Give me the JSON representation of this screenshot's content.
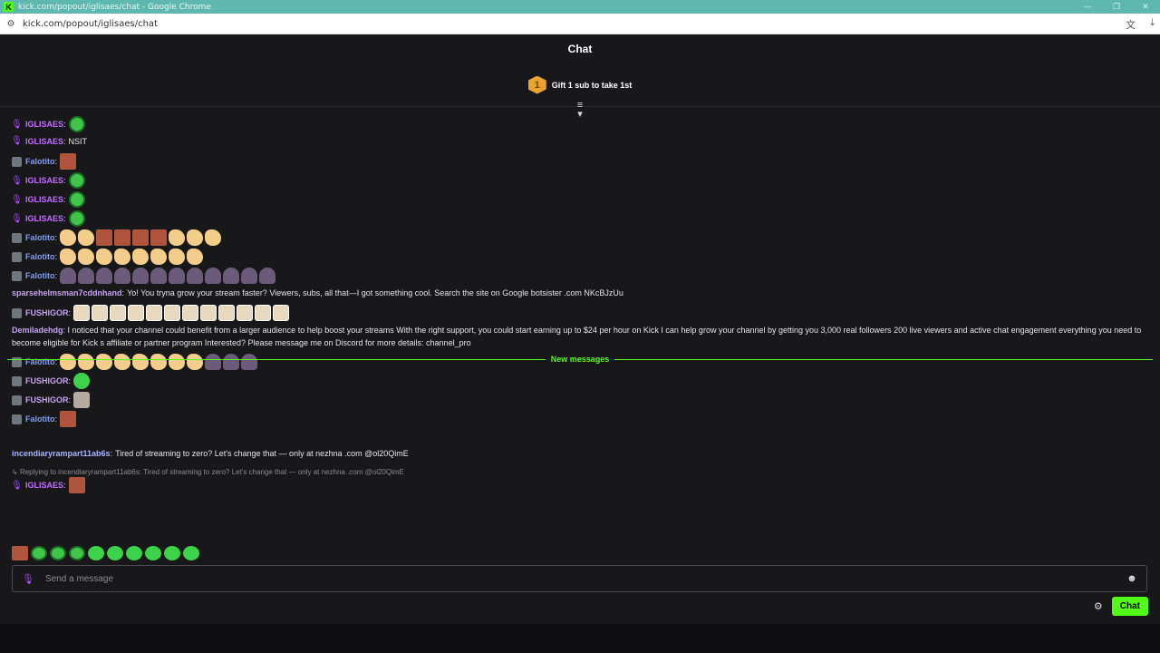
{
  "browser": {
    "window_title": "kick.com/popout/iglisaes/chat - Google Chrome",
    "url": "kick.com/popout/iglisaes/chat"
  },
  "chat": {
    "header": "Chat",
    "pinned_text": "Gift 1 sub to take 1st",
    "pinned_badge": "1",
    "new_messages_label": "New messages",
    "input_placeholder": "Send a message",
    "send_label": "Chat",
    "colors": {
      "accent": "#53fc18",
      "background": "#18181b",
      "mic": "#b04dff"
    }
  },
  "messages": [
    {
      "user": "IGLISAES",
      "badge": "mic",
      "text": ""
    },
    {
      "user": "IGLISAES",
      "badge": "mic",
      "text": "NSIT"
    },
    {
      "user": "Falotito",
      "badge": "sub",
      "text": ""
    },
    {
      "user": "IGLISAES",
      "badge": "mic",
      "text": ""
    },
    {
      "user": "IGLISAES",
      "badge": "mic",
      "text": ""
    },
    {
      "user": "IGLISAES",
      "badge": "mic",
      "text": ""
    },
    {
      "user": "Falotito",
      "badge": "sub",
      "text": ""
    },
    {
      "user": "Falotito",
      "badge": "sub",
      "text": ""
    },
    {
      "user": "Falotito",
      "badge": "sub",
      "text": ""
    },
    {
      "user": "sparsehelmsman7cddnhand",
      "badge": "",
      "text": "Yo! You tryna grow your stream faster? Viewers, subs, all that—I got something cool. Search the site on Google botsister .com NKcBJzUu"
    },
    {
      "user": "FUSHIGOR",
      "badge": "sub",
      "text": ""
    },
    {
      "user": "Demiladehdg",
      "badge": "",
      "text": "I noticed that your channel could benefit from a larger audience to help boost your streams With the right support, you could start earning up to $24 per hour on Kick I can help grow your channel by getting you 3,000 real followers 200 live viewers and active chat engagement everything you need to become eligible for Kick s affiliate or partner program Interested? Please message me on Discord for more details: channel_pro"
    },
    {
      "user": "Falotito",
      "badge": "sub",
      "text": ""
    },
    {
      "user": "FUSHIGOR",
      "badge": "sub",
      "text": ""
    },
    {
      "user": "FUSHIGOR",
      "badge": "sub",
      "text": ""
    },
    {
      "user": "Falotito",
      "badge": "sub",
      "text": ""
    },
    {
      "user": "incendiaryrampart11ab6s",
      "badge": "",
      "text": "Tired of streaming to zero? Let's change that — only at nezhna .com @ol20QimE"
    },
    {
      "user": "IGLISAES",
      "badge": "mic",
      "text": ""
    }
  ],
  "reply_context": "Replying to incendiaryrampart11ab6s: Tired of streaming to zero? Let's change that — only at nezhna .com @ol20QimE",
  "icons": [
    "kick-logo-icon",
    "site-settings-icon",
    "translate-icon",
    "download-icon",
    "mic-badge-icon",
    "subscriber-badge-icon",
    "scroll-down-icon",
    "reply-arrow-icon",
    "emoji-icon",
    "settings-gear-icon"
  ]
}
